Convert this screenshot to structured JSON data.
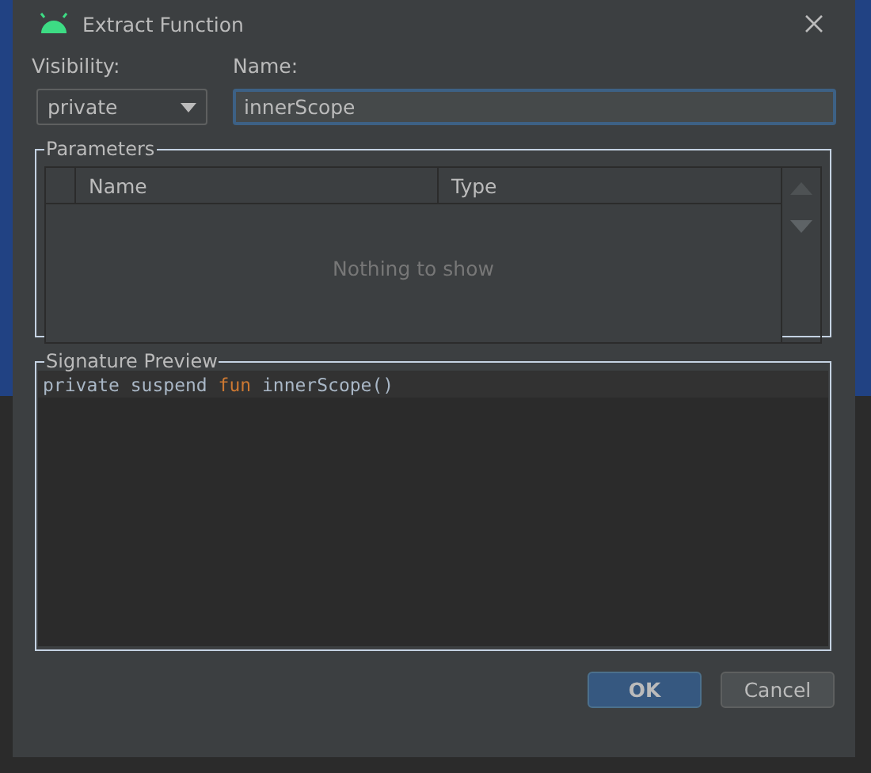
{
  "window": {
    "title": "Extract Function"
  },
  "visibility": {
    "label": "Visibility:",
    "value": "private"
  },
  "name": {
    "label": "Name:",
    "value": "innerScope",
    "focused": true
  },
  "parameters": {
    "title": "Parameters",
    "columns": [
      "Name",
      "Type"
    ],
    "empty_text": "Nothing to show"
  },
  "signature_preview": {
    "title": "Signature Preview",
    "tokens": [
      {
        "text": "private suspend ",
        "kind": "plain"
      },
      {
        "text": "fun",
        "kind": "keyword"
      },
      {
        "text": " innerScope()",
        "kind": "plain"
      }
    ]
  },
  "buttons": [
    {
      "label": "OK",
      "kind": "default"
    },
    {
      "label": "Cancel",
      "kind": "normal"
    }
  ]
}
